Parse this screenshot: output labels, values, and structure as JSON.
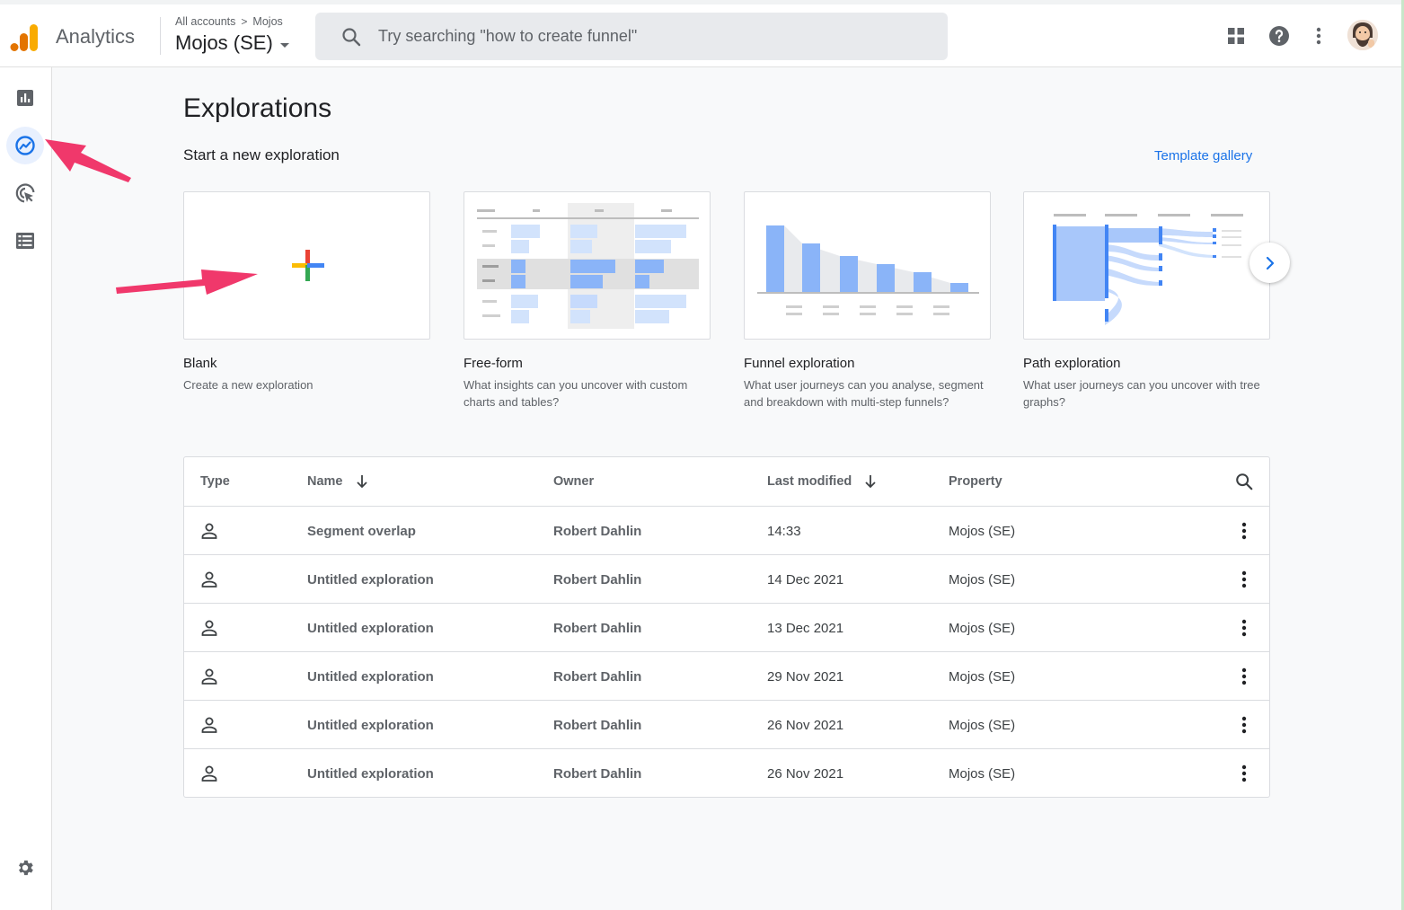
{
  "app": {
    "name": "Analytics",
    "breadcrumb": [
      "All accounts",
      "Mojos"
    ],
    "property": "Mojos (SE)",
    "search_placeholder": "Try searching \"how to create funnel\""
  },
  "colors": {
    "accent": "#1a73e8",
    "annotation_arrow": "#f0386b",
    "thumb_blue": "#8ab4f8",
    "thumb_light_blue": "#d2e3fc"
  },
  "rail": {
    "items": [
      {
        "name": "reports",
        "icon": "bar-chart-icon",
        "active": false
      },
      {
        "name": "explore",
        "icon": "explore-icon",
        "active": true
      },
      {
        "name": "advertising",
        "icon": "advertising-icon",
        "active": false
      },
      {
        "name": "configure",
        "icon": "list-icon",
        "active": false
      }
    ],
    "settings_icon": "gear-icon"
  },
  "page": {
    "title": "Explorations",
    "subtitle": "Start a new exploration",
    "template_link": "Template gallery"
  },
  "cards": [
    {
      "title": "Blank",
      "desc": "Create a new exploration"
    },
    {
      "title": "Free-form",
      "desc": "What insights can you uncover with custom charts and tables?"
    },
    {
      "title": "Funnel exploration",
      "desc": "What user journeys can you analyse, segment and breakdown with multi-step funnels?"
    },
    {
      "title": "Path exploration",
      "desc": "What user journeys can you uncover with tree graphs?"
    }
  ],
  "table": {
    "headers": {
      "type": "Type",
      "name": "Name",
      "owner": "Owner",
      "modified": "Last modified",
      "property": "Property"
    },
    "rows": [
      {
        "name": "Segment overlap",
        "owner": "Robert Dahlin",
        "modified": "14:33",
        "property": "Mojos (SE)"
      },
      {
        "name": "Untitled exploration",
        "owner": "Robert Dahlin",
        "modified": "14 Dec 2021",
        "property": "Mojos (SE)"
      },
      {
        "name": "Untitled exploration",
        "owner": "Robert Dahlin",
        "modified": "13 Dec 2021",
        "property": "Mojos (SE)"
      },
      {
        "name": "Untitled exploration",
        "owner": "Robert Dahlin",
        "modified": "29 Nov 2021",
        "property": "Mojos (SE)"
      },
      {
        "name": "Untitled exploration",
        "owner": "Robert Dahlin",
        "modified": "26 Nov 2021",
        "property": "Mojos (SE)"
      },
      {
        "name": "Untitled exploration",
        "owner": "Robert Dahlin",
        "modified": "26 Nov 2021",
        "property": "Mojos (SE)"
      }
    ]
  }
}
